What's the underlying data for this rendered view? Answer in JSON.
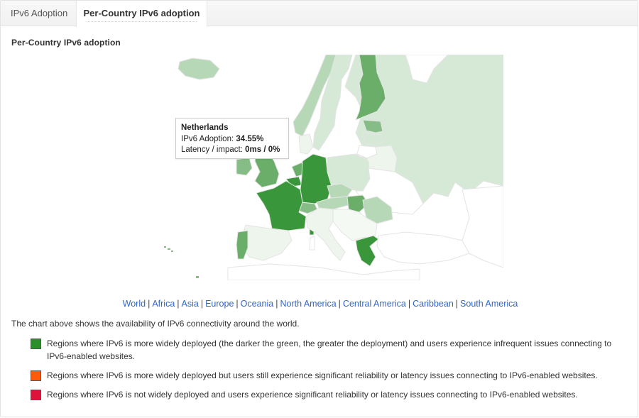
{
  "tabs": [
    {
      "label": "IPv6 Adoption",
      "active": false
    },
    {
      "label": "Per-Country IPv6 adoption",
      "active": true
    }
  ],
  "section_title": "Per-Country IPv6 adoption",
  "map": {
    "region_shown": "Europe",
    "colors": {
      "high": "#3a963a",
      "medium_high": "#6aae6a",
      "medium": "#86bd86",
      "low": "#b7d8b7",
      "very_low": "#d6e9d6",
      "minimal": "#edf5ed",
      "none": "#ffffff",
      "border": "#e4e4e4"
    },
    "countries": [
      {
        "name": "Iceland",
        "level": "low"
      },
      {
        "name": "Norway",
        "level": "low"
      },
      {
        "name": "Sweden",
        "level": "very_low"
      },
      {
        "name": "Finland",
        "level": "medium_high"
      },
      {
        "name": "Estonia",
        "level": "medium"
      },
      {
        "name": "Latvia",
        "level": "very_low"
      },
      {
        "name": "Lithuania",
        "level": "none"
      },
      {
        "name": "Russia",
        "level": "very_low"
      },
      {
        "name": "Belarus",
        "level": "minimal"
      },
      {
        "name": "Denmark",
        "level": "minimal"
      },
      {
        "name": "Ireland",
        "level": "medium"
      },
      {
        "name": "United Kingdom",
        "level": "medium_high"
      },
      {
        "name": "Netherlands",
        "level": "medium_high"
      },
      {
        "name": "Belgium",
        "level": "high"
      },
      {
        "name": "Germany",
        "level": "high"
      },
      {
        "name": "France",
        "level": "high"
      },
      {
        "name": "Switzerland",
        "level": "medium"
      },
      {
        "name": "Poland",
        "level": "very_low"
      },
      {
        "name": "Czechia",
        "level": "low"
      },
      {
        "name": "Austria",
        "level": "low"
      },
      {
        "name": "Hungary",
        "level": "medium_high"
      },
      {
        "name": "Romania",
        "level": "low"
      },
      {
        "name": "Portugal",
        "level": "medium_high"
      },
      {
        "name": "Spain",
        "level": "minimal"
      },
      {
        "name": "Italy",
        "level": "minimal"
      },
      {
        "name": "Greece",
        "level": "high"
      },
      {
        "name": "Ukraine",
        "level": "none"
      },
      {
        "name": "Turkey",
        "level": "none"
      }
    ]
  },
  "tooltip": {
    "country": "Netherlands",
    "adoption_label": "IPv6 Adoption:",
    "adoption_value": "34.55%",
    "latency_label": "Latency / impact:",
    "latency_value": "0ms / 0%"
  },
  "region_links": [
    "World",
    "Africa",
    "Asia",
    "Europe",
    "Oceania",
    "North America",
    "Central America",
    "Caribbean",
    "South America"
  ],
  "description": "The chart above shows the availability of IPv6 connectivity around the world.",
  "legend": [
    {
      "color": "#2b8f2b",
      "text": "Regions where IPv6 is more widely deployed (the darker the green, the greater the deployment) and users experience infrequent issues connecting to IPv6-enabled websites."
    },
    {
      "color": "#ff5a0a",
      "text": "Regions where IPv6 is more widely deployed but users still experience significant reliability or latency issues connecting to IPv6-enabled websites."
    },
    {
      "color": "#dc143c",
      "text": "Regions where IPv6 is not widely deployed and users experience significant reliability or latency issues connecting to IPv6-enabled websites."
    }
  ]
}
